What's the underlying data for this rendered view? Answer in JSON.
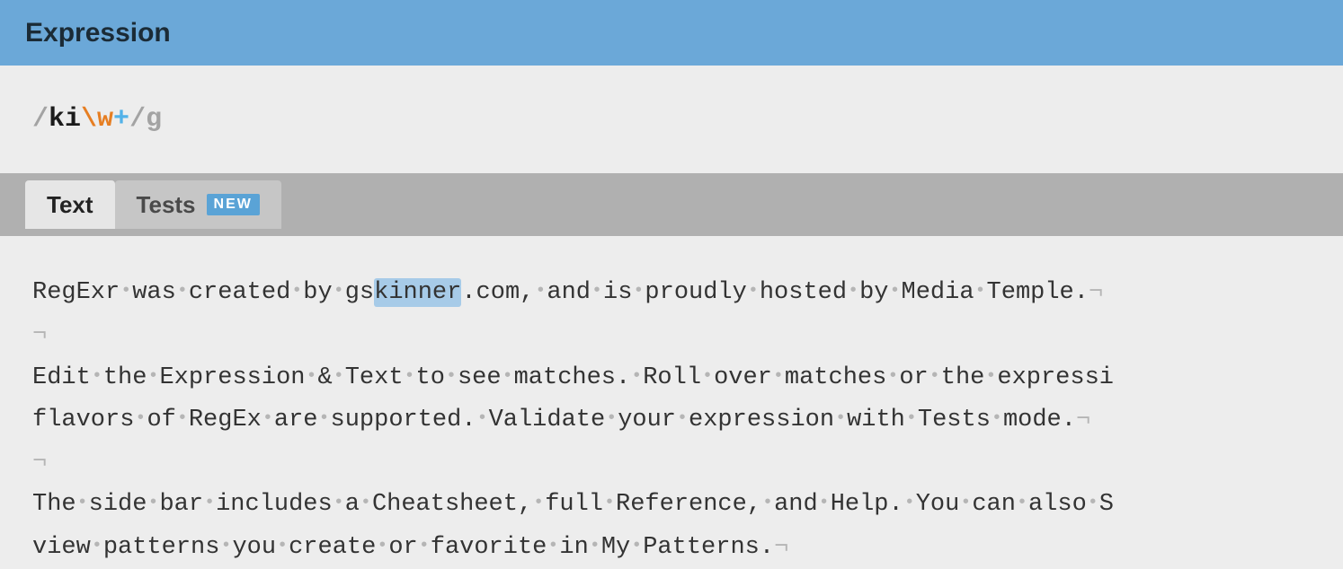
{
  "header": {
    "title": "Expression"
  },
  "expression": {
    "open_delim": "/",
    "literal": "ki",
    "charclass": "\\w",
    "quantifier": "+",
    "close_delim": "/",
    "flags": "g"
  },
  "tabs": {
    "text": {
      "label": "Text",
      "active": true
    },
    "tests": {
      "label": "Tests",
      "active": false,
      "badge": "NEW"
    }
  },
  "text_content": {
    "line1": {
      "tokens": [
        {
          "t": "w",
          "v": "RegExr"
        },
        {
          "t": "s"
        },
        {
          "t": "w",
          "v": "was"
        },
        {
          "t": "s"
        },
        {
          "t": "w",
          "v": "created"
        },
        {
          "t": "s"
        },
        {
          "t": "w",
          "v": "by"
        },
        {
          "t": "s"
        },
        {
          "t": "w",
          "v": "gs"
        },
        {
          "t": "m",
          "v": "kinner"
        },
        {
          "t": "w",
          "v": ".com,"
        },
        {
          "t": "s"
        },
        {
          "t": "w",
          "v": "and"
        },
        {
          "t": "s"
        },
        {
          "t": "w",
          "v": "is"
        },
        {
          "t": "s"
        },
        {
          "t": "w",
          "v": "proudly"
        },
        {
          "t": "s"
        },
        {
          "t": "w",
          "v": "hosted"
        },
        {
          "t": "s"
        },
        {
          "t": "w",
          "v": "by"
        },
        {
          "t": "s"
        },
        {
          "t": "w",
          "v": "Media"
        },
        {
          "t": "s"
        },
        {
          "t": "w",
          "v": "Temple."
        },
        {
          "t": "p"
        }
      ]
    },
    "line2": {
      "tokens": [
        {
          "t": "p"
        }
      ]
    },
    "line3": {
      "tokens": [
        {
          "t": "w",
          "v": "Edit"
        },
        {
          "t": "s"
        },
        {
          "t": "w",
          "v": "the"
        },
        {
          "t": "s"
        },
        {
          "t": "w",
          "v": "Expression"
        },
        {
          "t": "s"
        },
        {
          "t": "w",
          "v": "&"
        },
        {
          "t": "s"
        },
        {
          "t": "w",
          "v": "Text"
        },
        {
          "t": "s"
        },
        {
          "t": "w",
          "v": "to"
        },
        {
          "t": "s"
        },
        {
          "t": "w",
          "v": "see"
        },
        {
          "t": "s"
        },
        {
          "t": "w",
          "v": "matches."
        },
        {
          "t": "s"
        },
        {
          "t": "w",
          "v": "Roll"
        },
        {
          "t": "s"
        },
        {
          "t": "w",
          "v": "over"
        },
        {
          "t": "s"
        },
        {
          "t": "w",
          "v": "matches"
        },
        {
          "t": "s"
        },
        {
          "t": "w",
          "v": "or"
        },
        {
          "t": "s"
        },
        {
          "t": "w",
          "v": "the"
        },
        {
          "t": "s"
        },
        {
          "t": "w",
          "v": "expressi"
        }
      ]
    },
    "line4": {
      "tokens": [
        {
          "t": "w",
          "v": "flavors"
        },
        {
          "t": "s"
        },
        {
          "t": "w",
          "v": "of"
        },
        {
          "t": "s"
        },
        {
          "t": "w",
          "v": "RegEx"
        },
        {
          "t": "s"
        },
        {
          "t": "w",
          "v": "are"
        },
        {
          "t": "s"
        },
        {
          "t": "w",
          "v": "supported."
        },
        {
          "t": "s"
        },
        {
          "t": "w",
          "v": "Validate"
        },
        {
          "t": "s"
        },
        {
          "t": "w",
          "v": "your"
        },
        {
          "t": "s"
        },
        {
          "t": "w",
          "v": "expression"
        },
        {
          "t": "s"
        },
        {
          "t": "w",
          "v": "with"
        },
        {
          "t": "s"
        },
        {
          "t": "w",
          "v": "Tests"
        },
        {
          "t": "s"
        },
        {
          "t": "w",
          "v": "mode."
        },
        {
          "t": "p"
        }
      ]
    },
    "line5": {
      "tokens": [
        {
          "t": "p"
        }
      ]
    },
    "line6": {
      "tokens": [
        {
          "t": "w",
          "v": "The"
        },
        {
          "t": "s"
        },
        {
          "t": "w",
          "v": "side"
        },
        {
          "t": "s"
        },
        {
          "t": "w",
          "v": "bar"
        },
        {
          "t": "s"
        },
        {
          "t": "w",
          "v": "includes"
        },
        {
          "t": "s"
        },
        {
          "t": "w",
          "v": "a"
        },
        {
          "t": "s"
        },
        {
          "t": "w",
          "v": "Cheatsheet,"
        },
        {
          "t": "s"
        },
        {
          "t": "w",
          "v": "full"
        },
        {
          "t": "s"
        },
        {
          "t": "w",
          "v": "Reference,"
        },
        {
          "t": "s"
        },
        {
          "t": "w",
          "v": "and"
        },
        {
          "t": "s"
        },
        {
          "t": "w",
          "v": "Help."
        },
        {
          "t": "s"
        },
        {
          "t": "w",
          "v": "You"
        },
        {
          "t": "s"
        },
        {
          "t": "w",
          "v": "can"
        },
        {
          "t": "s"
        },
        {
          "t": "w",
          "v": "also"
        },
        {
          "t": "s"
        },
        {
          "t": "w",
          "v": "S"
        }
      ]
    },
    "line7": {
      "tokens": [
        {
          "t": "w",
          "v": "view"
        },
        {
          "t": "s"
        },
        {
          "t": "w",
          "v": "patterns"
        },
        {
          "t": "s"
        },
        {
          "t": "w",
          "v": "you"
        },
        {
          "t": "s"
        },
        {
          "t": "w",
          "v": "create"
        },
        {
          "t": "s"
        },
        {
          "t": "w",
          "v": "or"
        },
        {
          "t": "s"
        },
        {
          "t": "w",
          "v": "favorite"
        },
        {
          "t": "s"
        },
        {
          "t": "w",
          "v": "in"
        },
        {
          "t": "s"
        },
        {
          "t": "w",
          "v": "My"
        },
        {
          "t": "s"
        },
        {
          "t": "w",
          "v": "Patterns."
        },
        {
          "t": "p"
        }
      ]
    }
  },
  "glyphs": {
    "space_dot": "•",
    "pilcrow": "¬"
  }
}
